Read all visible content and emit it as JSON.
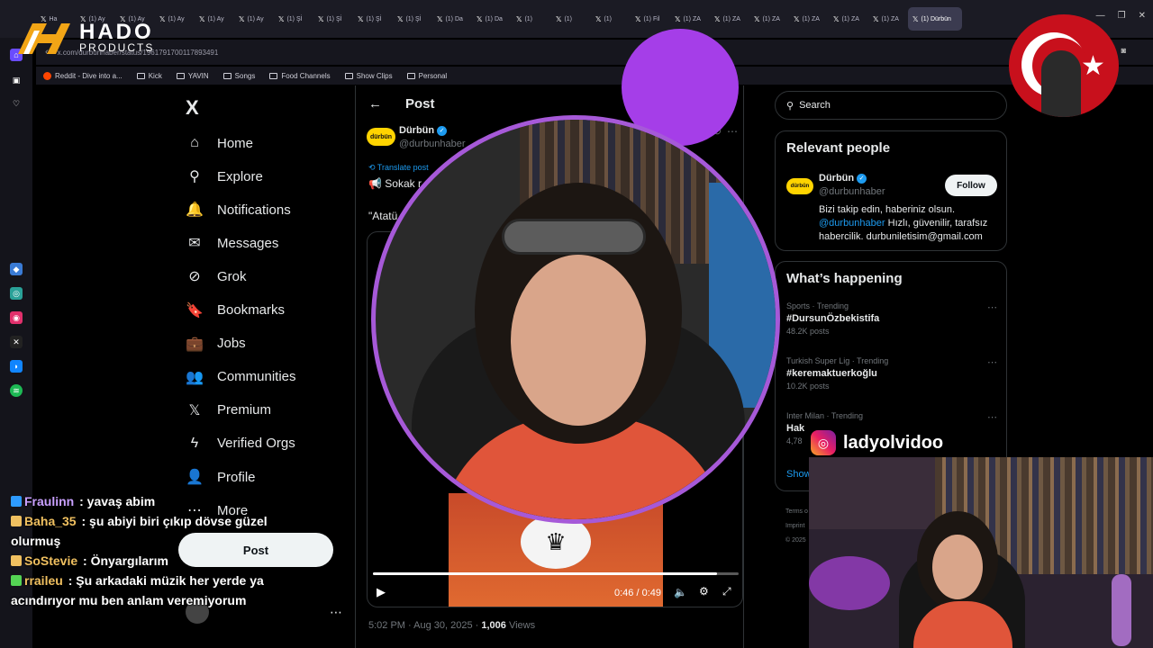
{
  "browser": {
    "tabs": [
      {
        "label": "Ha",
        "active": false
      },
      {
        "label": "(1) Ay",
        "active": false
      },
      {
        "label": "(1) Ay",
        "active": false
      },
      {
        "label": "(1) Ay",
        "active": false
      },
      {
        "label": "(1) Ay",
        "active": false
      },
      {
        "label": "(1) Ay",
        "active": false
      },
      {
        "label": "(1) Şİ",
        "active": false
      },
      {
        "label": "(1) Şİ",
        "active": false
      },
      {
        "label": "(1) Şİ",
        "active": false
      },
      {
        "label": "(1) Şİ",
        "active": false
      },
      {
        "label": "(1) Da",
        "active": false
      },
      {
        "label": "(1) Da",
        "active": false
      },
      {
        "label": "(1)",
        "active": false
      },
      {
        "label": "(1)",
        "active": false
      },
      {
        "label": "(1)",
        "active": false
      },
      {
        "label": "(1) Fil",
        "active": false
      },
      {
        "label": "(1) ZA",
        "active": false
      },
      {
        "label": "(1) ZA",
        "active": false
      },
      {
        "label": "(1) ZA",
        "active": false
      },
      {
        "label": "(1) ZA",
        "active": false
      },
      {
        "label": "(1) ZA",
        "active": false
      },
      {
        "label": "(1) ZA",
        "active": false
      },
      {
        "label": "(1) Dürbün",
        "active": true
      }
    ],
    "url": "x.com/durbunhaber/status/1961791700117893491",
    "bookmarks": [
      {
        "label": "Reddit - Dive into a...",
        "icon": "reddit-icon"
      },
      {
        "label": "Kick",
        "icon": "folder-icon"
      },
      {
        "label": "YAVIN",
        "icon": "folder-icon"
      },
      {
        "label": "Songs",
        "icon": "folder-icon"
      },
      {
        "label": "Food Channels",
        "icon": "folder-icon"
      },
      {
        "label": "Show Clips",
        "icon": "folder-icon"
      },
      {
        "label": "Personal",
        "icon": "folder-icon"
      }
    ]
  },
  "logo": {
    "title": "HADO",
    "subtitle": "PRODUCTS"
  },
  "nav": {
    "logo": "X",
    "items": [
      {
        "label": "Home",
        "icon": "home-icon",
        "glyph": "⌂"
      },
      {
        "label": "Explore",
        "icon": "search-icon",
        "glyph": "⚲"
      },
      {
        "label": "Notifications",
        "icon": "bell-icon",
        "glyph": "🔔"
      },
      {
        "label": "Messages",
        "icon": "mail-icon",
        "glyph": "✉"
      },
      {
        "label": "Grok",
        "icon": "grok-icon",
        "glyph": "⊘"
      },
      {
        "label": "Bookmarks",
        "icon": "bookmark-icon",
        "glyph": "🔖"
      },
      {
        "label": "Jobs",
        "icon": "briefcase-icon",
        "glyph": "💼"
      },
      {
        "label": "Communities",
        "icon": "communities-icon",
        "glyph": "👥"
      },
      {
        "label": "Premium",
        "icon": "x-premium-icon",
        "glyph": "𝕏"
      },
      {
        "label": "Verified Orgs",
        "icon": "lightning-icon",
        "glyph": "ϟ"
      },
      {
        "label": "Profile",
        "icon": "person-icon",
        "glyph": "👤"
      },
      {
        "label": "More",
        "icon": "more-circle-icon",
        "glyph": "⋯"
      }
    ],
    "post_label": "Post"
  },
  "post": {
    "heading": "Post",
    "author_name": "Dürbün",
    "author_handle": "@durbunhaber",
    "avatar_text": "dürbün",
    "translate": "Translate post",
    "text": "📢 Sokak r",
    "quote": "\"Atatü",
    "video_time": "0:46 / 0:49",
    "progress": 0.94,
    "timestamp": "5:02 PM · Aug 30, 2025 · ",
    "views_count": "1,006",
    "views_label": " Views"
  },
  "right": {
    "search_placeholder": "Search",
    "relevant": {
      "title": "Relevant people",
      "name": "Dürbün",
      "handle": "@durbunhaber",
      "follow": "Follow",
      "bio_1": "Bizi takip edin, haberiniz olsun. ",
      "bio_mention": "@durbunhaber",
      "bio_2": " Hızlı, güvenilir, tarafsız habercilik. durbuniletisim@gmail.com"
    },
    "happening": {
      "title": "What’s happening",
      "trends": [
        {
          "category": "Sports · Trending",
          "name": "#DursunÖzbekistifa",
          "posts": "48.2K posts"
        },
        {
          "category": "Turkish Super Lig · Trending",
          "name": "#keremaktuerkoğlu",
          "posts": "10.2K posts"
        },
        {
          "category": "Inter Milan · Trending",
          "name": "Hak",
          "posts": "4,78"
        }
      ],
      "show_more": "Show"
    },
    "footer_1": "Terms o",
    "footer_2": "Imprint",
    "footer_3": "© 2025"
  },
  "overlay": {
    "instagram_handle": "ladyolvidoo"
  },
  "chat": [
    {
      "user": "Fraulinn",
      "text": " : yavaş abim",
      "color": "#c9a0ff"
    },
    {
      "user": "Baha_35",
      "text": " : şu abiyi biri çıkıp dövse güzel olurmuş",
      "color": "#f0c060"
    },
    {
      "user": "SoStevie",
      "text": " : Önyargılarım",
      "color": "#f0c060"
    },
    {
      "user": "rraileu",
      "text": " : Şu arkadaki müzik her yerde ya acındırıyor mu ben anlam veremiyorum",
      "color": "#f0c060"
    }
  ]
}
